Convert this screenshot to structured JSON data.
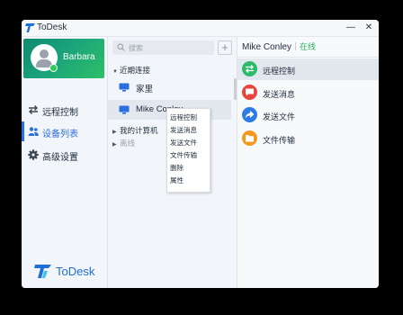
{
  "app": {
    "title": "ToDesk"
  },
  "window_controls": {
    "minimize": "—",
    "close": "✕"
  },
  "sidebar": {
    "user": {
      "name": "Barbara",
      "status_color": "#2ecc5a"
    },
    "items": [
      {
        "label": "远程控制",
        "icon": "arrows-exchange-icon",
        "active": false
      },
      {
        "label": "设备列表",
        "icon": "users-icon",
        "active": true
      },
      {
        "label": "高级设置",
        "icon": "gear-icon",
        "active": false
      }
    ],
    "brand": "ToDesk",
    "accent": "#2a6fe0"
  },
  "device_list": {
    "search_placeholder": "搜索",
    "add_label": "+",
    "groups": [
      {
        "label": "近期连接",
        "expanded": true
      },
      {
        "label": "我的计算机",
        "expanded": false
      },
      {
        "label": "离线",
        "expanded": false
      }
    ],
    "devices": [
      {
        "name": "家里"
      },
      {
        "name": "Mike Conley"
      }
    ]
  },
  "context_menu": {
    "items": [
      "远程控制",
      "发送消息",
      "发送文件",
      "文件传输",
      "删除",
      "属性"
    ]
  },
  "detail": {
    "device_name": "Mike Conley",
    "status": "在线",
    "status_color": "#27b35a",
    "actions": [
      {
        "label": "远程控制",
        "icon": "arrows-exchange-icon",
        "color": "#2dbb6a"
      },
      {
        "label": "发送消息",
        "icon": "message-icon",
        "color": "#e8453c"
      },
      {
        "label": "发送文件",
        "icon": "share-arrow-icon",
        "color": "#2f7be6"
      },
      {
        "label": "文件传输",
        "icon": "folder-icon",
        "color": "#f39a1e"
      }
    ]
  }
}
